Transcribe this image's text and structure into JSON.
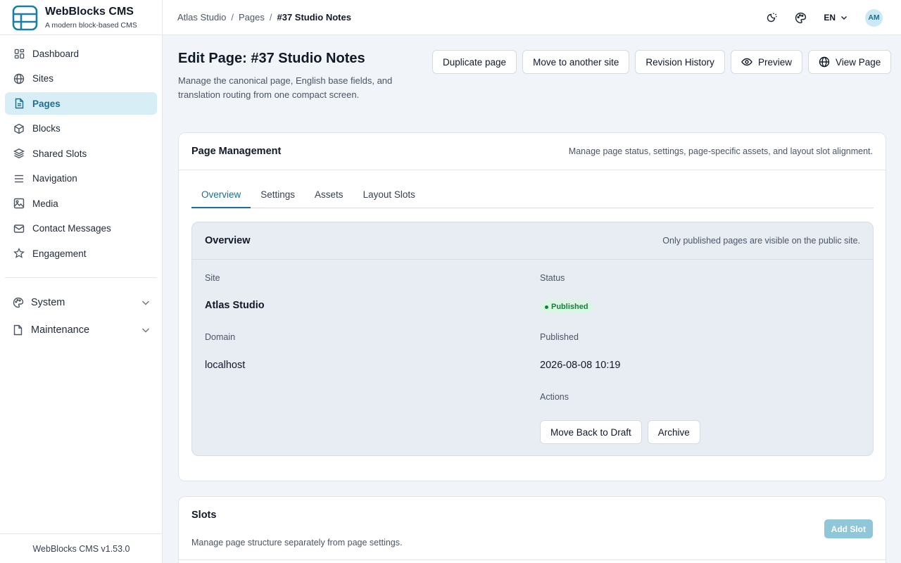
{
  "brand": {
    "name": "WebBlocks CMS",
    "tagline": "A modern block-based CMS"
  },
  "sidebar": {
    "items": [
      {
        "label": "Dashboard",
        "icon": "dashboard-icon",
        "active": false
      },
      {
        "label": "Sites",
        "icon": "globe-icon",
        "active": false
      },
      {
        "label": "Pages",
        "icon": "document-icon",
        "active": true
      },
      {
        "label": "Blocks",
        "icon": "cube-icon",
        "active": false
      },
      {
        "label": "Shared Slots",
        "icon": "layers-icon",
        "active": false
      },
      {
        "label": "Navigation",
        "icon": "menu-icon",
        "active": false
      },
      {
        "label": "Media",
        "icon": "image-icon",
        "active": false
      },
      {
        "label": "Contact Messages",
        "icon": "mail-icon",
        "active": false
      },
      {
        "label": "Engagement",
        "icon": "star-icon",
        "active": false
      }
    ],
    "groups": [
      {
        "label": "System",
        "icon": "palette-icon"
      },
      {
        "label": "Maintenance",
        "icon": "file-icon"
      }
    ],
    "version": "WebBlocks CMS v1.53.0"
  },
  "topbar": {
    "breadcrumb": [
      "Atlas Studio",
      "Pages",
      "#37 Studio Notes"
    ],
    "language": "EN",
    "avatar_initials": "AM"
  },
  "page": {
    "title": "Edit Page: #37 Studio Notes",
    "description": "Manage the canonical page, English base fields, and translation routing from one compact screen.",
    "actions": {
      "duplicate": "Duplicate page",
      "move": "Move to another site",
      "revisions": "Revision History",
      "preview": "Preview",
      "view": "View Page"
    }
  },
  "management": {
    "title": "Page Management",
    "note": "Manage page status, settings, page-specific assets, and layout slot alignment.",
    "tabs": [
      "Overview",
      "Settings",
      "Assets",
      "Layout Slots"
    ],
    "active_tab": "Overview"
  },
  "overview": {
    "title": "Overview",
    "note": "Only published pages are visible on the public site.",
    "site_label": "Site",
    "site_value": "Atlas Studio",
    "status_label": "Status",
    "status_value": "Published",
    "status_color": "#15803d",
    "domain_label": "Domain",
    "domain_value": "localhost",
    "published_label": "Published",
    "published_value": "2026-08-08 10:19",
    "actions_label": "Actions",
    "draft_button": "Move Back to Draft",
    "archive_button": "Archive"
  },
  "slots": {
    "title": "Slots",
    "description": "Manage page structure separately from page settings.",
    "add_button": "Add Slot"
  },
  "colors": {
    "accent": "#1d6f8e",
    "accent_soft": "#d8eef6",
    "background": "#f1f4f8"
  }
}
